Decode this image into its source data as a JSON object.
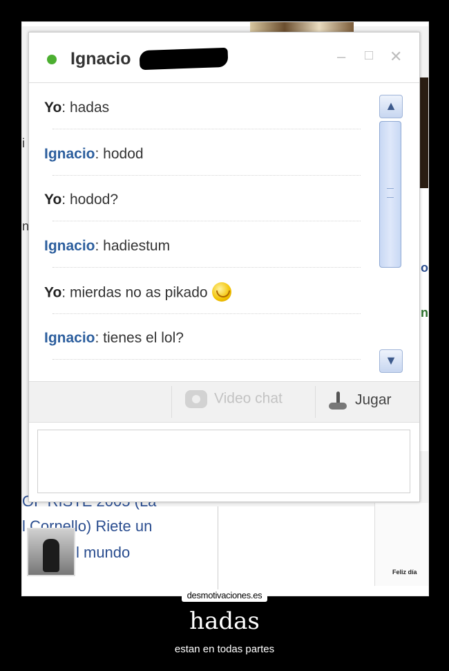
{
  "chat": {
    "contact_name": "Ignacio",
    "status_color": "#4caf31",
    "controls": {
      "minimize": "–",
      "maximize": "□",
      "close": "✕"
    },
    "messages": [
      {
        "sender": "Yo",
        "text": ": hadas"
      },
      {
        "sender": "Ignacio",
        "text": ": hodod"
      },
      {
        "sender": "Yo",
        "text": ": hodod?"
      },
      {
        "sender": "Ignacio",
        "text": ": hadiestum"
      },
      {
        "sender": "Yo",
        "text": ": mierdas no as pikado",
        "emoticon": "smiley-icon"
      },
      {
        "sender": "Ignacio",
        "text": ": tienes el lol?"
      }
    ],
    "toolbar": {
      "video_chat": "Video chat",
      "play": "Jugar"
    },
    "input_value": ""
  },
  "background_page": {
    "text_line_1": "OF    RISTE 2005 (La",
    "text_line_2": "l Cornello) Riete un",
    "text_line_3": "l mundo",
    "card_text": "Feliz día"
  },
  "poster": {
    "site": "desmotivaciones.es",
    "title": "hadas",
    "subtitle": "estan en todas partes"
  }
}
